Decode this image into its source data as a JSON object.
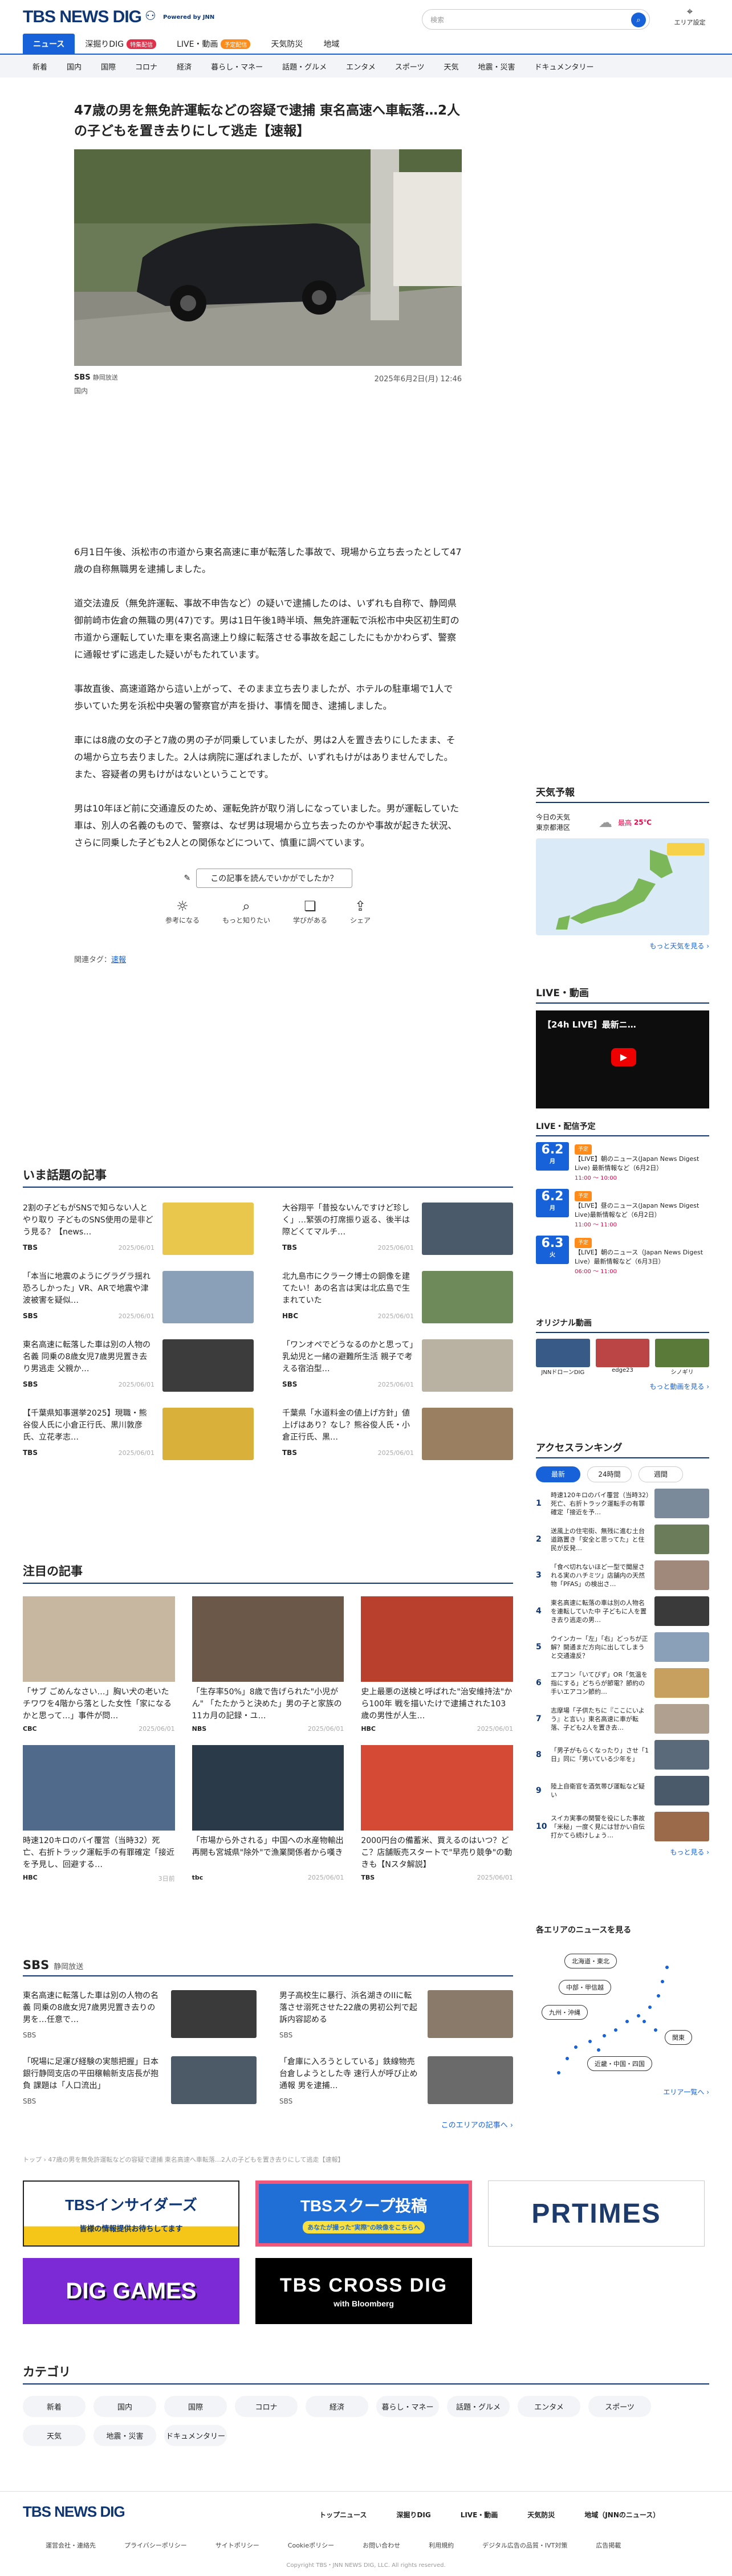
{
  "header": {
    "logo": "TBS NEWS DIG",
    "powered_by": "Powered by JNN",
    "search_placeholder": "検索",
    "area_label": "エリア設定"
  },
  "nav": {
    "items": [
      {
        "label": "ニュース",
        "active": true
      },
      {
        "label": "深掘りDIG",
        "badge": "特集配信"
      },
      {
        "label": "LIVE・動画",
        "badge": "予定配信"
      },
      {
        "label": "天気防災"
      },
      {
        "label": "地域"
      }
    ]
  },
  "subnav": [
    "新着",
    "国内",
    "国際",
    "コロナ",
    "経済",
    "暮らし・マネー",
    "話題・グルメ",
    "エンタメ",
    "スポーツ",
    "天気",
    "地震・災害",
    "ドキュメンタリー"
  ],
  "article": {
    "title": "47歳の男を無免許運転などの容疑で逮捕 東名高速へ車転落…2人の子どもを置き去りにして逃走【速報】",
    "source": "SBS",
    "source_sub": "静岡放送",
    "date": "2025年6月2日(月) 12:46",
    "category": "国内",
    "paragraphs": [
      "6月1日午後、浜松市の市道から東名高速に車が転落した事故で、現場から立ち去ったとして47歳の自称無職男を逮捕しました。",
      "道交法違反（無免許運転、事故不申告など）の疑いで逮捕したのは、いずれも自称で、静岡県御前崎市佐倉の無職の男(47)です。男は1日午後1時半頃、無免許運転で浜松市中央区初生町の市道から運転していた車を東名高速上り線に転落させる事故を起こしたにもかかわらず、警察に通報せずに逃走した疑いがもたれています。",
      "事故直後、高速道路から這い上がって、そのまま立ち去りましたが、ホテルの駐車場で1人で歩いていた男を浜松中央署の警察官が声を掛け、事情を聞き、逮捕しました。",
      "車には8歳の女の子と7歳の男の子が同乗していましたが、男は2人を置き去りにしたまま、その場から立ち去りました。2人は病院に運ばれましたが、いずれもけがはありませんでした。また、容疑者の男もけがはないということです。",
      "男は10年ほど前に交通違反のため、運転免許が取り消しになっていました。男が運転していた車は、別人の名義のもので、警察は、なぜ男は現場から立ち去ったのかや事故が起きた状況、さらに同乗した子ども2人との関係などについて、慎重に調べています。"
    ],
    "feedback_question": "この記事を読んでいかがでしたか？",
    "reactions": [
      {
        "label": "参考になる",
        "icon": "lightbulb-icon"
      },
      {
        "label": "もっと知りたい",
        "icon": "magnifier-icon"
      },
      {
        "label": "学びがある",
        "icon": "book-icon"
      },
      {
        "label": "シェア",
        "icon": "share-icon"
      }
    ],
    "tags_label": "関連タグ：",
    "tag": "速報"
  },
  "trending": {
    "title": "いま話題の記事",
    "items": [
      {
        "text": "2割の子どもがSNSで知らない人とやり取り 子どものSNS使用の是非どう見る？【news…",
        "src": "TBS",
        "date": "2025/06/01",
        "color": "#e9c74c"
      },
      {
        "text": "大谷翔平「昔投ないんですけど珍しく」…緊張の打席振り返る、後半は際どくてマルチ…",
        "src": "TBS",
        "date": "2025/06/01",
        "color": "#4a5a6b"
      },
      {
        "text": "「本当に地震のようにグラグラ揺れ恐ろしかった」VR、ARで地震や津波被害を疑似…",
        "src": "SBS",
        "date": "2025/06/01",
        "color": "#8aa0b8"
      },
      {
        "text": "北九島市にクラーク博士の銅像を建てたい！あの名言は実は北広島で生まれていた",
        "src": "HBC",
        "date": "2025/06/01",
        "color": "#6f8a5a"
      },
      {
        "text": "東名高速に転落した車は別の人物の名義 同乗の8歳女児7歳男児置き去り男逃走 父親か…",
        "src": "SBS",
        "date": "2025/06/01",
        "color": "#3c3c3c"
      },
      {
        "text": "「ワンオペでどうなるのかと思って」乳幼児と一緒の避難所生活 親子で考える宿泊型…",
        "src": "SBS",
        "date": "2025/06/01",
        "color": "#b9b2a2"
      },
      {
        "text": "【千葉県知事選挙2025】現職・熊谷俊人氏に小倉正行氏、黒川敦彦氏、立花孝志…",
        "src": "TBS",
        "date": "2025/06/01",
        "color": "#d8b03a"
      },
      {
        "text": "千葉県「水道料金の値上げ方針」値上げはあり？なし？熊谷俊人氏・小倉正行氏、黒…",
        "src": "TBS",
        "date": "2025/06/01",
        "color": "#9a8060"
      }
    ]
  },
  "featured": {
    "title": "注目の記事",
    "items": [
      {
        "text": "「サブ ごめんなさい…」胸い犬の老いたチワワを4階から落とした女性「家になるかと思って…」事件が問…",
        "src": "CBC",
        "date": "2025/06/01",
        "color": "#c7b7a1"
      },
      {
        "text": "「生存率50%」8歳で告げられた\"小児がん\" 「たたかうと決めた」男の子と家族の11カ月の記録・ユ…",
        "src": "NBS",
        "date": "2025/06/01",
        "color": "#6b5848"
      },
      {
        "text": "史上最悪の送検と呼ばれた\"治安維持法\"から100年 戦を描いたけで逮捕された103歳の男性が人生…",
        "src": "HBC",
        "date": "2025/06/01",
        "color": "#b8402c"
      },
      {
        "text": "時速120キロのバイ覆営（当時32）死亡、右折トラック運転手の有罪確定「接近を予見し、回避する…",
        "src": "HBC",
        "date": "3日前",
        "color": "#4f6a8a"
      },
      {
        "text": "「市場から外される」中国への水産物輸出再開も宮城県\"除外\"で漁業関係者から嘆き",
        "src": "tbc",
        "date": "2025/06/01",
        "color": "#2b3a48"
      },
      {
        "text": "2000円台の備蓄米、買えるのはいつ？どこ？店舗販売スタートで\"早売り競争\"の動きも【Nスタ解説】",
        "src": "TBS",
        "date": "2025/06/01",
        "color": "#d44a34"
      }
    ]
  },
  "sbs": {
    "title": "SBS",
    "subtitle": "静岡放送",
    "items": [
      {
        "text": "東名高速に転落した車は別の人物の名義 同乗の8歳女児7歳男児置き去りの男を…任意で…",
        "src": "SBS",
        "color": "#3a3a3a"
      },
      {
        "text": "男子高校生に暴行、浜名湖きのIIに転落させ溺死させた22歳の男初公判で起訴内容認める",
        "src": "SBS",
        "color": "#8a7a6a"
      },
      {
        "text": "「呪場に足運び経験の実態把握」日本銀行静岡支店の平田穣輸新支店長が抱負 課題は「人口流出」",
        "src": "SBS",
        "color": "#4c5a68"
      },
      {
        "text": "「倉庫に入ろうとしている」鉄線物売台倉しようとした寺 速行人が呼び止め通報 男を逮捕…",
        "src": "SBS",
        "color": "#6a6a6a"
      }
    ],
    "more": "このエリアの記事へ"
  },
  "breadcrumb": "トップ › 47歳の男を無免許運転などの容疑で逮捕 東名高速へ車転落…2人の子どもを置き去りにして逃走【速報】",
  "banners": [
    {
      "name": "TBSインサイダーズ",
      "text": "TBSインサイダーズ",
      "sub": "皆様の情報提供お待ちしてます"
    },
    {
      "name": "TBSスクープ投稿",
      "text": "TBSスクープ投稿",
      "sub": "あなたが撮った\"実際\"の映像をこちらへ"
    },
    {
      "name": "PR TIMES",
      "text": "PRTIMES",
      "sub": ""
    },
    {
      "name": "DIG GAMES",
      "text": "DIG GAMES",
      "sub": ""
    },
    {
      "name": "TBS CROSS DIG",
      "text": "TBS CROSS DIG",
      "sub": "with Bloomberg"
    }
  ],
  "categories": {
    "title": "カテゴリ",
    "items": [
      "新着",
      "国内",
      "国際",
      "コロナ",
      "経済",
      "暮らし・マネー",
      "話題・グルメ",
      "エンタメ",
      "スポーツ",
      "天気",
      "地震・災害",
      "ドキュメンタリー"
    ]
  },
  "footer": {
    "logo": "TBS NEWS DIG",
    "links1": [
      "トップニュース",
      "深掘りDIG",
      "LIVE・動画",
      "天気防災",
      "地域（JNNのニュース）"
    ],
    "links2": [
      "運営会社・連絡先",
      "プライバシーポリシー",
      "サイトポリシー",
      "Cookieポリシー",
      "お問い合わせ",
      "利用規約",
      "デジタル広告の品質・IVT対策",
      "広告掲載"
    ],
    "copyright": "Copyright TBS・JNN NEWS DIG, LLC. All rights reserved."
  },
  "sidebar": {
    "weather": {
      "title": "天気予報",
      "loc1": "今日の天気",
      "loc2": "東京都港区",
      "hi": "最高",
      "hi_val": "25℃",
      "more": "もっと天気を見る"
    },
    "live": {
      "title": "LIVE・動画",
      "video_title": "【24h LIVE】最新ニ…"
    },
    "schedule": {
      "title": "LIVE・配信予定",
      "items": [
        {
          "date": "6.2",
          "day": "月",
          "tag": "予定",
          "text": "【LIVE】朝のニュース(Japan News Digest Live) 最新情報など（6月2日）",
          "time": "11:00 〜 10:00"
        },
        {
          "date": "6.2",
          "day": "月",
          "tag": "予定",
          "text": "【LIVE】昼のニュース(Japan News Digest Live)最新情報など（6月2日）",
          "time": "11:00 〜 11:00"
        },
        {
          "date": "6.3",
          "day": "火",
          "tag": "予定",
          "text": "【LIVE】朝のニュース（Japan News Digest Live）最新情報など（6月3日）",
          "time": "06:00 〜 11:00"
        }
      ]
    },
    "original": {
      "title": "オリジナル動画",
      "items": [
        "JNNドローンDIG",
        "edge23",
        "シノギリ"
      ],
      "more": "もっと動画を見る"
    },
    "ranking": {
      "title": "アクセスランキング",
      "tabs": [
        "最新",
        "24時間",
        "週間"
      ],
      "items": [
        "時速120キロのバイ覆営（当時32）死亡、右折トラック運転手の有罪確定「接近を予…",
        "送風上の住宅街、無残に進む土台道路置き「安全と思ってた」と住民が反発…",
        "「食べ切れないほど一型で聞屋される実のハチミツ」店舗内の天然物「PFAS」の検出さ…",
        "東名高速に転落の車は別の人物名を連転していた中 子どもに人を置き去り逃走の男…",
        "ウインカー「左」「右」どっちが正解？開通まだ方向に出してしまうと交通違反？",
        "エアコン「いてびず」OR「気温を指にする」どちらが節電？節約の手いエアコン節約…",
        "志摩場「子供たちに『ここにいよう』と言い」東名高速に車が転落、子ども2人を置き去…",
        "「男子がもらくなったり」させ「1日」同に「男いている少年を」",
        "陸上自衛官を酒気帯び運転など疑い",
        "スイカ実事の関警を役にした事故「米秘」一度く見には甘かい自伝打かてら続けしょう…"
      ],
      "more": "もっと見る"
    },
    "region": {
      "title": "各エリアのニュースを見る",
      "buttons": [
        "北海道・東北",
        "中部・甲信越",
        "九州・沖縄",
        "関東",
        "近畿・中国・四国"
      ],
      "more": "エリア一覧へ"
    }
  }
}
